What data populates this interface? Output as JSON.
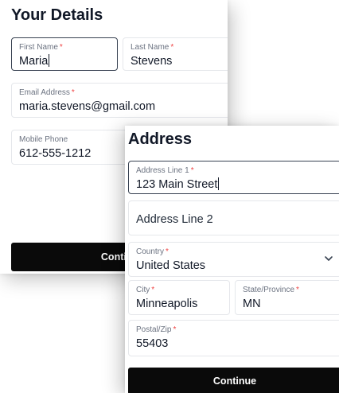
{
  "details": {
    "title": "Your Details",
    "first_name": {
      "label": "First Name",
      "value": "Maria"
    },
    "last_name": {
      "label": "Last Name",
      "value": "Stevens"
    },
    "email": {
      "label": "Email Address",
      "value": "maria.stevens@gmail.com"
    },
    "mobile": {
      "label": "Mobile Phone",
      "value": "612-555-1212"
    },
    "continue_label": "Continue",
    "required_marker": "*"
  },
  "address": {
    "title": "Address",
    "line1": {
      "label": "Address Line 1",
      "value": "123 Main Street"
    },
    "line2": {
      "placeholder": "Address Line 2"
    },
    "country": {
      "label": "Country",
      "value": "United States",
      "icon": "chevron-down-icon"
    },
    "city": {
      "label": "City",
      "value": "Minneapolis"
    },
    "state": {
      "label": "State/Province",
      "value": "MN"
    },
    "postal": {
      "label": "Postal/Zip",
      "value": "55403"
    },
    "continue_label": "Continue",
    "required_marker": "*"
  },
  "colors": {
    "required": "#ef4444",
    "button_bg": "#0a0a0a",
    "focus_border": "#374151"
  }
}
